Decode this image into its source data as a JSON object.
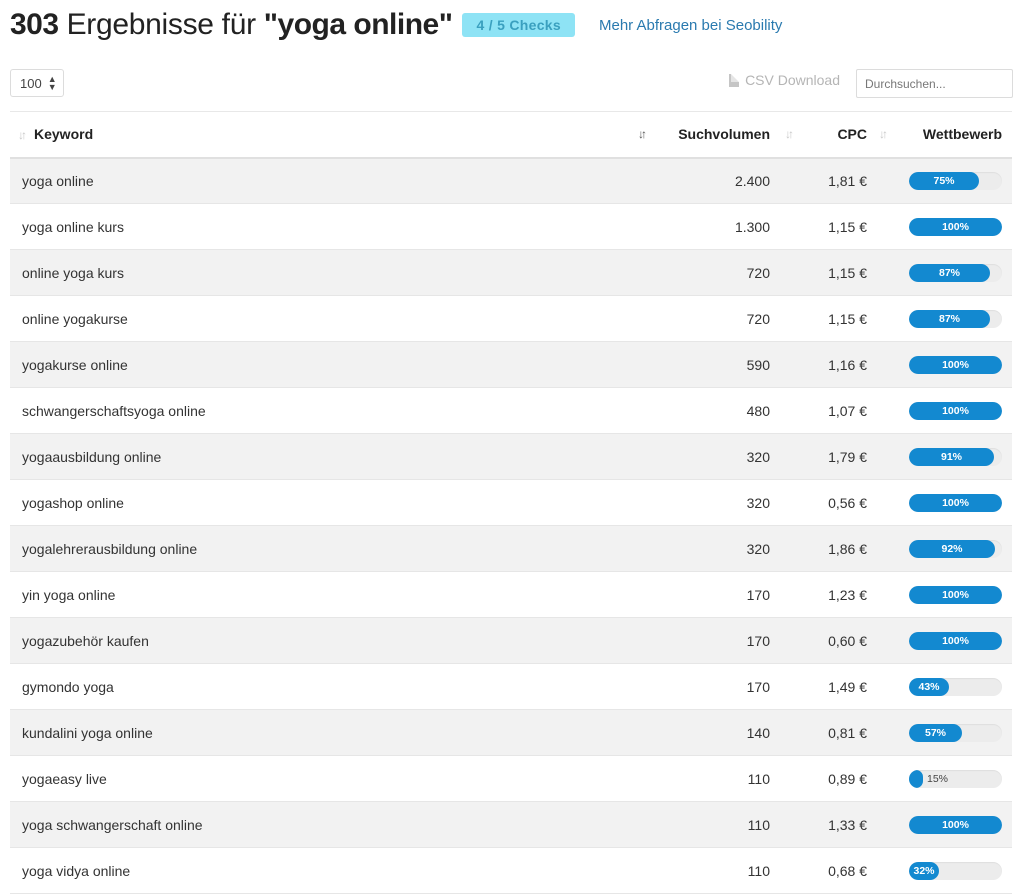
{
  "header": {
    "count": "303",
    "text": "Ergebnisse für",
    "query": "\"yoga online\"",
    "badge": "4 / 5 Checks",
    "link": "Mehr Abfragen bei Seobility"
  },
  "toolbar": {
    "per_page": "100",
    "csv": "CSV Download",
    "search_placeholder": "Durchsuchen..."
  },
  "columns": {
    "keyword": "Keyword",
    "volume": "Suchvolumen",
    "cpc": "CPC",
    "competition": "Wettbewerb"
  },
  "rows": [
    {
      "keyword": "yoga online",
      "volume": "2.400",
      "cpc": "1,81 €",
      "competition_pct": 75,
      "competition": "75%"
    },
    {
      "keyword": "yoga online kurs",
      "volume": "1.300",
      "cpc": "1,15 €",
      "competition_pct": 100,
      "competition": "100%"
    },
    {
      "keyword": "online yoga kurs",
      "volume": "720",
      "cpc": "1,15 €",
      "competition_pct": 87,
      "competition": "87%"
    },
    {
      "keyword": "online yogakurse",
      "volume": "720",
      "cpc": "1,15 €",
      "competition_pct": 87,
      "competition": "87%"
    },
    {
      "keyword": "yogakurse online",
      "volume": "590",
      "cpc": "1,16 €",
      "competition_pct": 100,
      "competition": "100%"
    },
    {
      "keyword": "schwangerschaftsyoga online",
      "volume": "480",
      "cpc": "1,07 €",
      "competition_pct": 100,
      "competition": "100%"
    },
    {
      "keyword": "yogaausbildung online",
      "volume": "320",
      "cpc": "1,79 €",
      "competition_pct": 91,
      "competition": "91%"
    },
    {
      "keyword": "yogashop online",
      "volume": "320",
      "cpc": "0,56 €",
      "competition_pct": 100,
      "competition": "100%"
    },
    {
      "keyword": "yogalehrerausbildung online",
      "volume": "320",
      "cpc": "1,86 €",
      "competition_pct": 92,
      "competition": "92%"
    },
    {
      "keyword": "yin yoga online",
      "volume": "170",
      "cpc": "1,23 €",
      "competition_pct": 100,
      "competition": "100%"
    },
    {
      "keyword": "yogazubehör kaufen",
      "volume": "170",
      "cpc": "0,60 €",
      "competition_pct": 100,
      "competition": "100%"
    },
    {
      "keyword": "gymondo yoga",
      "volume": "170",
      "cpc": "1,49 €",
      "competition_pct": 43,
      "competition": "43%"
    },
    {
      "keyword": "kundalini yoga online",
      "volume": "140",
      "cpc": "0,81 €",
      "competition_pct": 57,
      "competition": "57%"
    },
    {
      "keyword": "yogaeasy live",
      "volume": "110",
      "cpc": "0,89 €",
      "competition_pct": 15,
      "competition": "15%"
    },
    {
      "keyword": "yoga schwangerschaft online",
      "volume": "110",
      "cpc": "1,33 €",
      "competition_pct": 100,
      "competition": "100%"
    },
    {
      "keyword": "yoga vidya online",
      "volume": "110",
      "cpc": "0,68 €",
      "competition_pct": 32,
      "competition": "32%"
    }
  ],
  "colors": {
    "accent": "#1389d0",
    "badge_bg": "#8ee3f5",
    "link": "#2a7aaf"
  }
}
